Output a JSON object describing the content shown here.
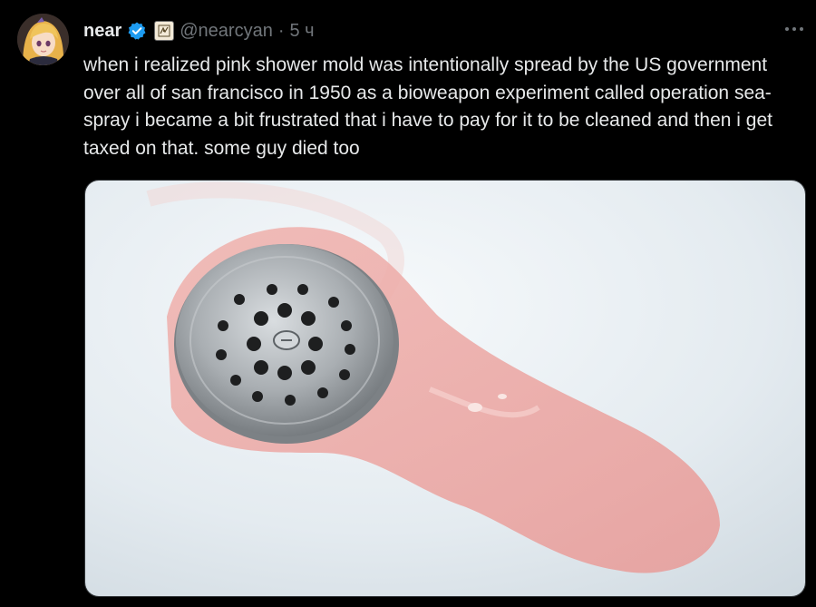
{
  "tweet": {
    "author": {
      "display_name": "near",
      "handle": "@nearcyan",
      "verified_icon": "verified-badge-icon",
      "affiliation_icon": "affiliate-badge-icon"
    },
    "separator": "·",
    "timestamp": "5 ч",
    "more_icon": "more-icon",
    "text": "when i realized pink shower mold was intentionally spread by the US government over all of san francisco in 1950 as a bioweapon experiment called operation sea-spray i became a bit frustrated that i have to pay for it to be cleaned and then i get taxed on that. some guy died too",
    "media": {
      "kind": "photo"
    }
  },
  "colors": {
    "background": "#000000",
    "text_primary": "#e7e9ea",
    "text_secondary": "#71767b",
    "verified_blue": "#1d9bf0",
    "tub_white": "#e6edf2",
    "mold_pink": "#e9a3a3"
  }
}
